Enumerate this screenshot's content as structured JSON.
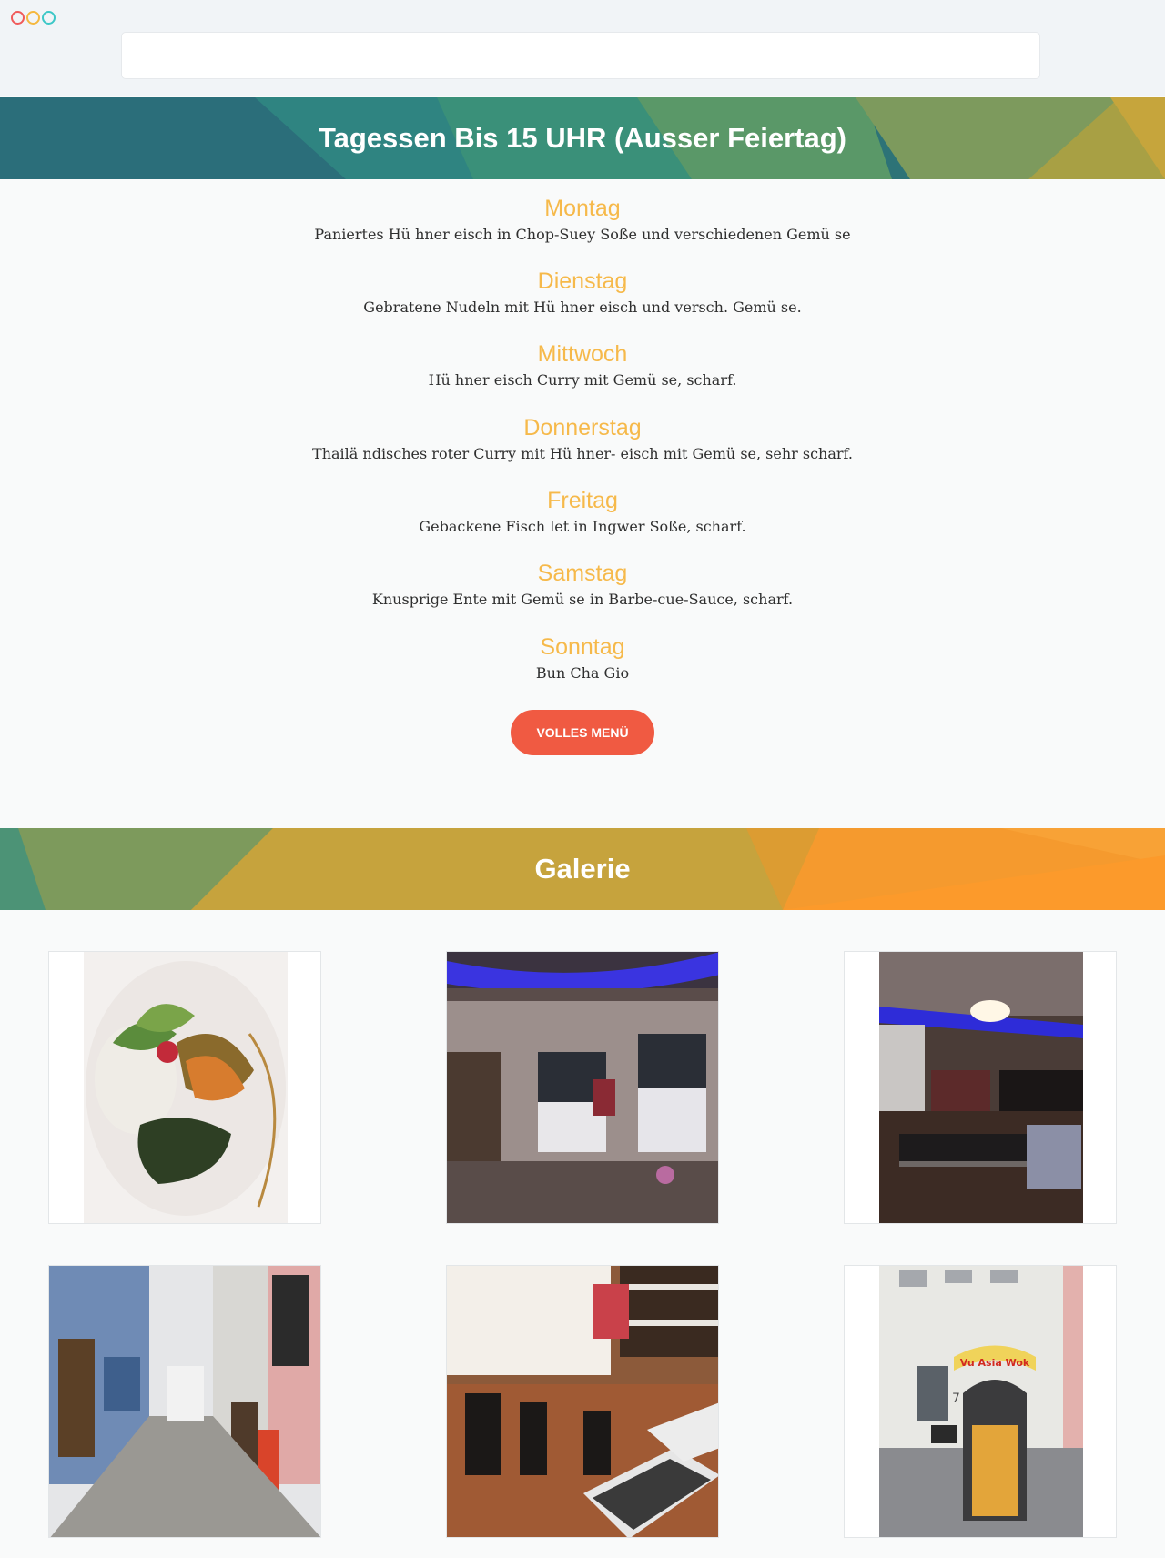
{
  "browser": {
    "controls": [
      "close",
      "minimize",
      "maximize"
    ],
    "url": ""
  },
  "daily_menu": {
    "title": "Tagessen Bis 15 UHR (Ausser Feiertag)",
    "days": [
      {
        "name": "Montag",
        "dish": "Paniertes Hü hner eisch in Chop-Suey Soße und verschiedenen Gemü se"
      },
      {
        "name": "Dienstag",
        "dish": "Gebratene Nudeln mit Hü hner eisch und versch. Gemü se."
      },
      {
        "name": "Mittwoch",
        "dish": "Hü hner eisch Curry mit Gemü se, scharf."
      },
      {
        "name": "Donnerstag",
        "dish": "Thailä ndisches roter Curry mit Hü hner- eisch mit Gemü se, sehr scharf."
      },
      {
        "name": "Freitag",
        "dish": "Gebackene Fisch let in Ingwer Soße, scharf."
      },
      {
        "name": "Samstag",
        "dish": "Knusprige Ente mit Gemü se in Barbe-cue-Sauce, scharf."
      },
      {
        "name": "Sonntag",
        "dish": "Bun Cha Gio"
      }
    ],
    "button_label": "VOLLES MENÜ"
  },
  "gallery": {
    "title": "Galerie",
    "images": [
      {
        "subject": "salad-dish"
      },
      {
        "subject": "dining-room-windows"
      },
      {
        "subject": "dining-room-bar"
      },
      {
        "subject": "alley-street"
      },
      {
        "subject": "restaurant-tables"
      },
      {
        "subject": "storefront-entrance",
        "sign_text": "Vu Asia Wok",
        "house_number": "7"
      }
    ]
  },
  "colors": {
    "accent": "#f6b94a",
    "button": "#f05a42",
    "banner_teal": "#2c7378",
    "banner_orange": "#fa9a2c"
  }
}
